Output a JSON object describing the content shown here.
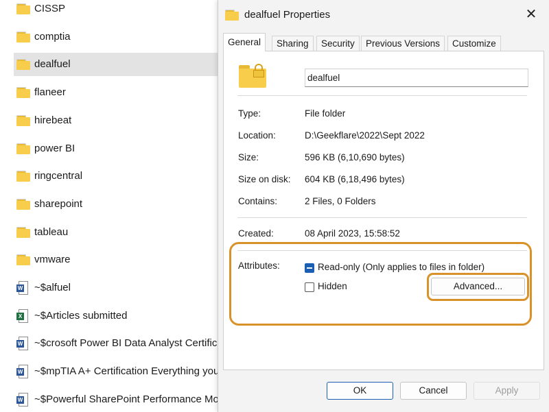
{
  "explorer": {
    "items": [
      {
        "name": "CISSP",
        "type": "folder"
      },
      {
        "name": "comptia",
        "type": "folder"
      },
      {
        "name": "dealfuel",
        "type": "folder",
        "selected": true
      },
      {
        "name": "flaneer",
        "type": "folder"
      },
      {
        "name": "hirebeat",
        "type": "folder"
      },
      {
        "name": "power BI",
        "type": "folder"
      },
      {
        "name": "ringcentral",
        "type": "folder"
      },
      {
        "name": "sharepoint",
        "type": "folder"
      },
      {
        "name": "tableau",
        "type": "folder"
      },
      {
        "name": "vmware",
        "type": "folder"
      },
      {
        "name": "~$alfuel",
        "type": "word"
      },
      {
        "name": "~$Articles submitted",
        "type": "excel"
      },
      {
        "name": "~$crosoft Power BI Data Analyst Certification",
        "type": "word"
      },
      {
        "name": "~$mpTIA A+ Certification Everything you need",
        "type": "word"
      },
      {
        "name": "~$Powerful SharePoint Performance Monitoring",
        "type": "word"
      }
    ]
  },
  "dialog": {
    "title": "dealfuel Properties",
    "close_glyph": "✕",
    "tabs": [
      "General",
      "Sharing",
      "Security",
      "Previous Versions",
      "Customize"
    ],
    "active_tab": "General",
    "folder_name": "dealfuel",
    "properties": {
      "type_label": "Type:",
      "type_value": "File folder",
      "location_label": "Location:",
      "location_value": "D:\\Geekflare\\2022\\Sept 2022",
      "size_label": "Size:",
      "size_value": "596 KB (6,10,690 bytes)",
      "size_on_disk_label": "Size on disk:",
      "size_on_disk_value": "604 KB (6,18,496 bytes)",
      "contains_label": "Contains:",
      "contains_value": "2 Files, 0 Folders",
      "created_label": "Created:",
      "created_value": "08 April 2023, 15:58:52"
    },
    "attributes": {
      "label": "Attributes:",
      "readonly_label": "Read-only (Only applies to files in folder)",
      "readonly_state": "indeterminate",
      "hidden_label": "Hidden",
      "hidden_state": "unchecked",
      "advanced_button": "Advanced..."
    },
    "buttons": {
      "ok": "OK",
      "cancel": "Cancel",
      "apply": "Apply"
    },
    "highlight_color": "#d9922a"
  }
}
